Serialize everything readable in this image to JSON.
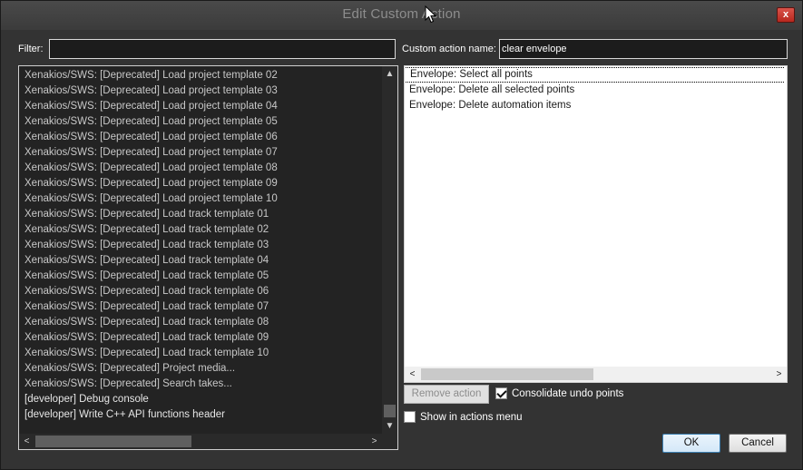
{
  "window": {
    "title": "Edit Custom Action",
    "close_glyph": "x"
  },
  "filter": {
    "label": "Filter:",
    "value": "",
    "placeholder": ""
  },
  "custom_action_name": {
    "label": "Custom action name:",
    "value": "clear envelope"
  },
  "action_list": {
    "items": [
      "Xenakios/SWS: [Deprecated] Load project template 02",
      "Xenakios/SWS: [Deprecated] Load project template 03",
      "Xenakios/SWS: [Deprecated] Load project template 04",
      "Xenakios/SWS: [Deprecated] Load project template 05",
      "Xenakios/SWS: [Deprecated] Load project template 06",
      "Xenakios/SWS: [Deprecated] Load project template 07",
      "Xenakios/SWS: [Deprecated] Load project template 08",
      "Xenakios/SWS: [Deprecated] Load project template 09",
      "Xenakios/SWS: [Deprecated] Load project template 10",
      "Xenakios/SWS: [Deprecated] Load track template 01",
      "Xenakios/SWS: [Deprecated] Load track template 02",
      "Xenakios/SWS: [Deprecated] Load track template 03",
      "Xenakios/SWS: [Deprecated] Load track template 04",
      "Xenakios/SWS: [Deprecated] Load track template 05",
      "Xenakios/SWS: [Deprecated] Load track template 06",
      "Xenakios/SWS: [Deprecated] Load track template 07",
      "Xenakios/SWS: [Deprecated] Load track template 08",
      "Xenakios/SWS: [Deprecated] Load track template 09",
      "Xenakios/SWS: [Deprecated] Load track template 10",
      "Xenakios/SWS: [Deprecated] Project media...",
      "Xenakios/SWS: [Deprecated] Search takes...",
      "[developer] Debug console",
      "[developer] Write C++ API functions header"
    ]
  },
  "custom_action_steps": {
    "items": [
      "Envelope: Select all points",
      "Envelope: Delete all selected points",
      "Envelope: Delete automation items"
    ],
    "selected_index": 0
  },
  "scroll_glyphs": {
    "up": "▲",
    "down": "▼",
    "left": "<",
    "right": ">"
  },
  "buttons": {
    "remove_action": "Remove action",
    "ok": "OK",
    "cancel": "Cancel"
  },
  "checkboxes": {
    "consolidate_undo": {
      "label": "Consolidate undo points",
      "checked": true
    },
    "show_in_menu": {
      "label": "Show in actions menu",
      "checked": false
    }
  },
  "icons": {
    "close": "close-icon",
    "cursor": "arrow-cursor-icon"
  }
}
